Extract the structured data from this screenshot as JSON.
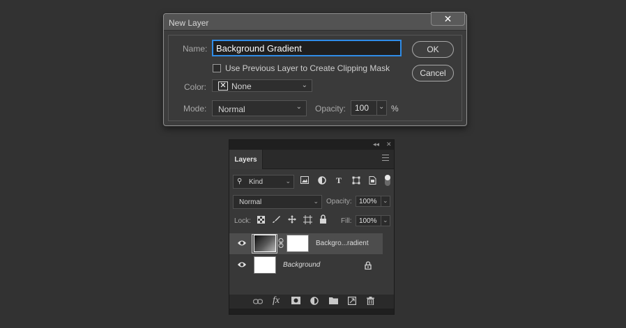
{
  "dialog": {
    "title": "New Layer",
    "close_label": "✕",
    "name_label": "Name:",
    "name_value": "Background Gradient",
    "clip_label": "Use Previous Layer to Create Clipping Mask",
    "clip_checked": false,
    "color_label": "Color:",
    "color_value": "None",
    "mode_label": "Mode:",
    "mode_value": "Normal",
    "opacity_label": "Opacity:",
    "opacity_value": "100",
    "opacity_unit": "%",
    "ok_label": "OK",
    "cancel_label": "Cancel"
  },
  "layers_panel": {
    "tab_label": "Layers",
    "kind_label": "Kind",
    "blend_mode": "Normal",
    "opacity_label": "Opacity:",
    "opacity_value": "100%",
    "lock_label": "Lock:",
    "fill_label": "Fill:",
    "fill_value": "100%",
    "layers": [
      {
        "name": "Backgro...radient",
        "selected": true,
        "thumb": "gradient",
        "has_mask": true,
        "locked": false
      },
      {
        "name": "Background",
        "selected": false,
        "thumb": "white",
        "has_mask": false,
        "locked": true
      }
    ],
    "filter_icons": [
      "image-filter-icon",
      "adjustment-filter-icon",
      "type-filter-icon",
      "shape-filter-icon",
      "smart-object-filter-icon"
    ],
    "bottom_icons": [
      "link-layers-icon",
      "fx-icon",
      "add-mask-icon",
      "adjustment-layer-icon",
      "group-folder-icon",
      "new-layer-icon",
      "trash-icon"
    ]
  },
  "colors": {
    "background": "#323232",
    "accent": "#2f8ce8",
    "selected_row": "#4d4d4d"
  }
}
